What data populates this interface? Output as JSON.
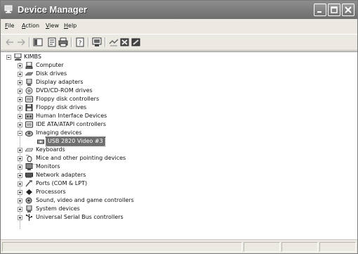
{
  "window": {
    "title": "Device Manager"
  },
  "menu": {
    "file": {
      "mnemonic": "F",
      "rest": "ile"
    },
    "action": {
      "mnemonic": "A",
      "rest": "ction"
    },
    "view": {
      "mnemonic": "V",
      "rest": "iew"
    },
    "help": {
      "mnemonic": "H",
      "rest": "elp"
    }
  },
  "toolbar": {
    "icons": [
      "back-arrow-icon",
      "forward-arrow-icon",
      "show-hide-console-tree-icon",
      "properties-icon",
      "print-icon",
      "help-icon",
      "scan-hardware-icon",
      "update-driver-icon",
      "uninstall-icon",
      "disable-icon"
    ]
  },
  "tree": {
    "root": "KIMBS",
    "items": [
      {
        "label": "Computer",
        "icon": "computer-icon"
      },
      {
        "label": "Disk drives",
        "icon": "disk-drive-icon"
      },
      {
        "label": "Display adapters",
        "icon": "display-adapter-icon"
      },
      {
        "label": "DVD/CD-ROM drives",
        "icon": "cdrom-icon"
      },
      {
        "label": "Floppy disk controllers",
        "icon": "floppy-controller-icon"
      },
      {
        "label": "Floppy disk drives",
        "icon": "floppy-drive-icon"
      },
      {
        "label": "Human Interface Devices",
        "icon": "hid-icon"
      },
      {
        "label": "IDE ATA/ATAPI controllers",
        "icon": "ide-controller-icon"
      },
      {
        "label": "Imaging devices",
        "icon": "imaging-device-icon"
      },
      {
        "label": "USB 2820 Video #3",
        "icon": "camera-icon"
      },
      {
        "label": "Keyboards",
        "icon": "keyboard-icon"
      },
      {
        "label": "Mice and other pointing devices",
        "icon": "mouse-icon"
      },
      {
        "label": "Monitors",
        "icon": "monitor-icon"
      },
      {
        "label": "Network adapters",
        "icon": "network-adapter-icon"
      },
      {
        "label": "Ports (COM & LPT)",
        "icon": "port-icon"
      },
      {
        "label": "Processors",
        "icon": "processor-icon"
      },
      {
        "label": "Sound, video and game controllers",
        "icon": "sound-icon"
      },
      {
        "label": "System devices",
        "icon": "system-device-icon"
      },
      {
        "label": "Universal Serial Bus controllers",
        "icon": "usb-icon"
      }
    ]
  }
}
